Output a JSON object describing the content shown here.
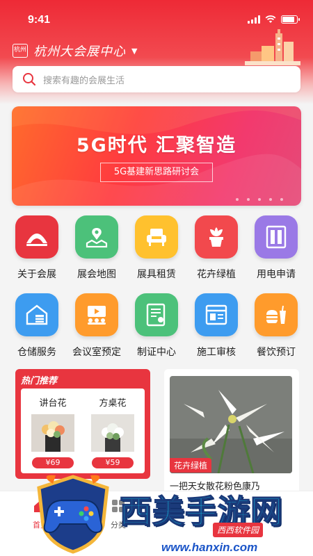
{
  "status_bar": {
    "time": "9:41"
  },
  "header": {
    "venue_name": "杭州大会展中心",
    "logo_text": "杭州",
    "dropdown_icon": "caret-down-icon",
    "accent": "#e8353f"
  },
  "search": {
    "placeholder": "搜索有趣的会展生活",
    "icon": "search-icon"
  },
  "banner": {
    "title": "5G时代 汇聚智造",
    "subtitle": "5G基建新思路研讨会"
  },
  "services": [
    {
      "label": "关于会展",
      "icon": "pavilion-icon",
      "color": "#e8353f"
    },
    {
      "label": "展会地图",
      "icon": "map-icon",
      "color": "#4cc17a"
    },
    {
      "label": "展具租赁",
      "icon": "sofa-icon",
      "color": "#ffc12e"
    },
    {
      "label": "花卉绿植",
      "icon": "plant-icon",
      "color": "#f2494d"
    },
    {
      "label": "用电申请",
      "icon": "power-cabinet-icon",
      "color": "#9a79e6"
    },
    {
      "label": "仓储服务",
      "icon": "warehouse-icon",
      "color": "#3d9cf0"
    },
    {
      "label": "会议室预定",
      "icon": "meeting-room-icon",
      "color": "#ff9b2c"
    },
    {
      "label": "制证中心",
      "icon": "certificate-icon",
      "color": "#4cc17a"
    },
    {
      "label": "施工审核",
      "icon": "construction-review-icon",
      "color": "#3d9cf0"
    },
    {
      "label": "餐饮预订",
      "icon": "food-icon",
      "color": "#ff9b2c"
    }
  ],
  "hot": {
    "title": "热门推荐",
    "products": [
      {
        "name": "讲台花",
        "price": "¥69"
      },
      {
        "name": "方桌花",
        "price": "¥59"
      }
    ]
  },
  "feature": {
    "tag": "花卉绿植",
    "title": "一把天女散花粉色康乃"
  },
  "tabbar": [
    {
      "label": "首页",
      "icon": "home-icon"
    },
    {
      "label": "分类",
      "icon": "category-icon"
    }
  ],
  "watermark": {
    "text": "西美手游网",
    "badge": "西西软件园",
    "url": "www.hanxin.com"
  }
}
